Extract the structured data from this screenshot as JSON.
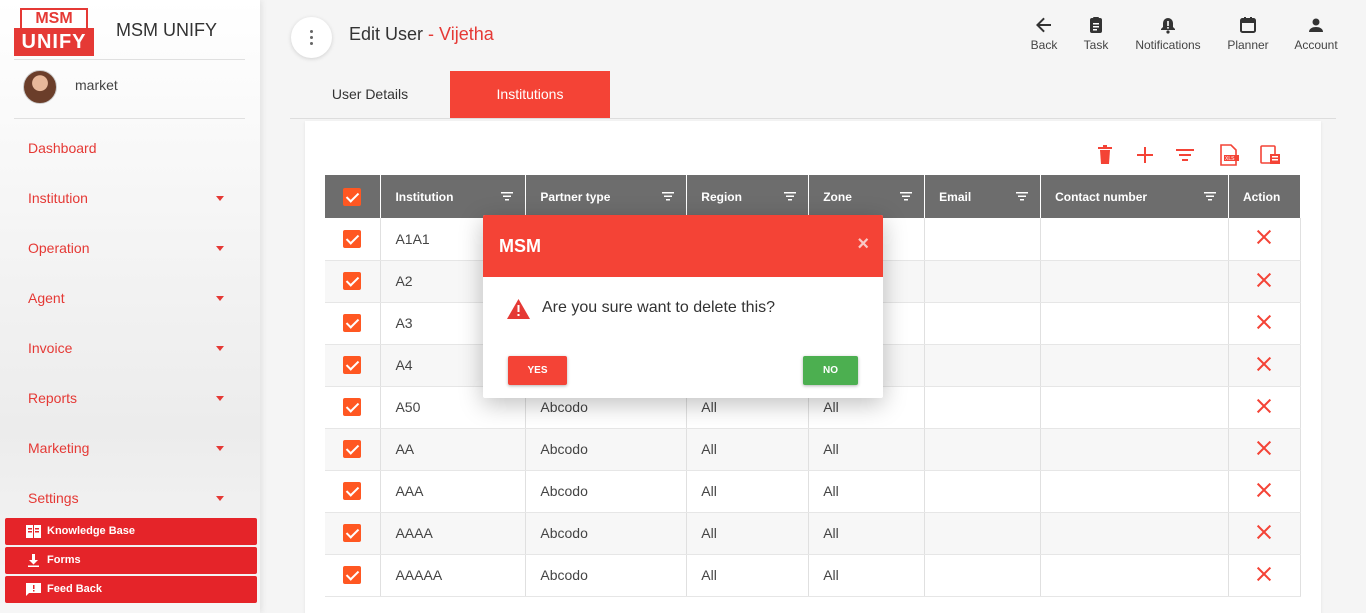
{
  "brand": {
    "logo_top": "MSM",
    "logo_bottom": "UNIFY",
    "app_name": "MSM UNIFY"
  },
  "user": {
    "name": "market"
  },
  "sidebar": {
    "nav": [
      {
        "label": "Dashboard",
        "has_caret": false
      },
      {
        "label": "Institution",
        "has_caret": true
      },
      {
        "label": "Operation",
        "has_caret": true
      },
      {
        "label": "Agent",
        "has_caret": true
      },
      {
        "label": "Invoice",
        "has_caret": true
      },
      {
        "label": "Reports",
        "has_caret": true
      },
      {
        "label": "Marketing",
        "has_caret": true
      },
      {
        "label": "Settings",
        "has_caret": true
      }
    ],
    "buttons": [
      {
        "label": "Knowledge Base",
        "icon": "book-icon"
      },
      {
        "label": "Forms",
        "icon": "download-icon"
      },
      {
        "label": "Feed Back",
        "icon": "feedback-icon"
      }
    ]
  },
  "header": {
    "title": "Edit User",
    "title_suffix": " - Vijetha",
    "actions": [
      "Back",
      "Task",
      "Notifications",
      "Planner",
      "Account"
    ]
  },
  "tabs": {
    "user_details": "User Details",
    "institutions": "Institutions",
    "active": "Institutions"
  },
  "table": {
    "columns": [
      "Institution",
      "Partner type",
      "Region",
      "Zone",
      "Email",
      "Contact number",
      "Action"
    ],
    "rows": [
      {
        "institution": "A1A1",
        "partner_type": "",
        "region": "",
        "zone": ""
      },
      {
        "institution": "A2",
        "partner_type": "",
        "region": "",
        "zone": ""
      },
      {
        "institution": "A3",
        "partner_type": "",
        "region": "",
        "zone": ""
      },
      {
        "institution": "A4",
        "partner_type": "",
        "region": "",
        "zone": ""
      },
      {
        "institution": "A50",
        "partner_type": "Abcodo",
        "region": "All",
        "zone": "All"
      },
      {
        "institution": "AA",
        "partner_type": "Abcodo",
        "region": "All",
        "zone": "All"
      },
      {
        "institution": "AAA",
        "partner_type": "Abcodo",
        "region": "All",
        "zone": "All"
      },
      {
        "institution": "AAAA",
        "partner_type": "Abcodo",
        "region": "All",
        "zone": "All"
      },
      {
        "institution": "AAAAA",
        "partner_type": "Abcodo",
        "region": "All",
        "zone": "All"
      }
    ]
  },
  "dialog": {
    "title": "MSM",
    "close": "×",
    "message": "Are you sure want to delete this?",
    "yes": "YES",
    "no": "NO"
  },
  "colors": {
    "accent": "#f44336",
    "success": "#4caf50",
    "checkbox": "#ff5722",
    "header_bg": "#6d6d6d"
  }
}
